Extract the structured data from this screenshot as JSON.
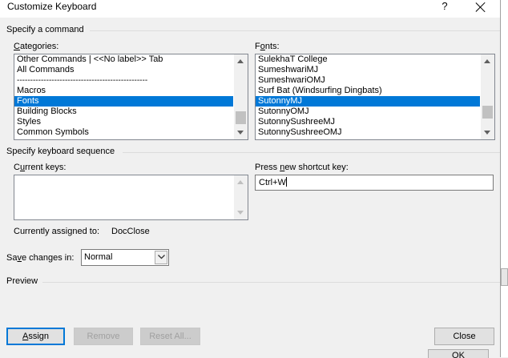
{
  "window": {
    "title": "Customize Keyboard",
    "help_glyph": "?"
  },
  "specify_command": {
    "heading": "Specify a command",
    "categories": {
      "label": "Categories:",
      "items": [
        "Other Commands | <<No label>> Tab",
        "All Commands",
        "-------------------------------------------------",
        "Macros",
        "Fonts",
        "Building Blocks",
        "Styles",
        "Common Symbols"
      ],
      "selected": "Fonts"
    },
    "fonts": {
      "label": "Fonts:",
      "items": [
        "SulekhaT College",
        "SumeshwariMJ",
        "SumeshwariOMJ",
        "Surf Bat (Windsurfing Dingbats)",
        "SutonnyMJ",
        "SutonnyOMJ",
        "SutonnySushreeMJ",
        "SutonnySushreeOMJ"
      ],
      "selected": "SutonnyMJ"
    }
  },
  "keyboard_sequence": {
    "heading": "Specify keyboard sequence",
    "current_keys_label": "Current keys:",
    "new_shortcut_label": "Press new shortcut key:",
    "new_shortcut_value": "Ctrl+W"
  },
  "assigned": {
    "label": "Currently assigned to:",
    "value": "DocClose"
  },
  "save_changes": {
    "label": "Save changes in:",
    "value": "Normal"
  },
  "preview": {
    "heading": "Preview"
  },
  "buttons": {
    "assign": "Assign",
    "remove": "Remove",
    "reset_all": "Reset All...",
    "close": "Close"
  },
  "background": {
    "ok_label": "OK"
  },
  "colors": {
    "selection": "#0078d7",
    "default_button_border": "#0078d7"
  }
}
